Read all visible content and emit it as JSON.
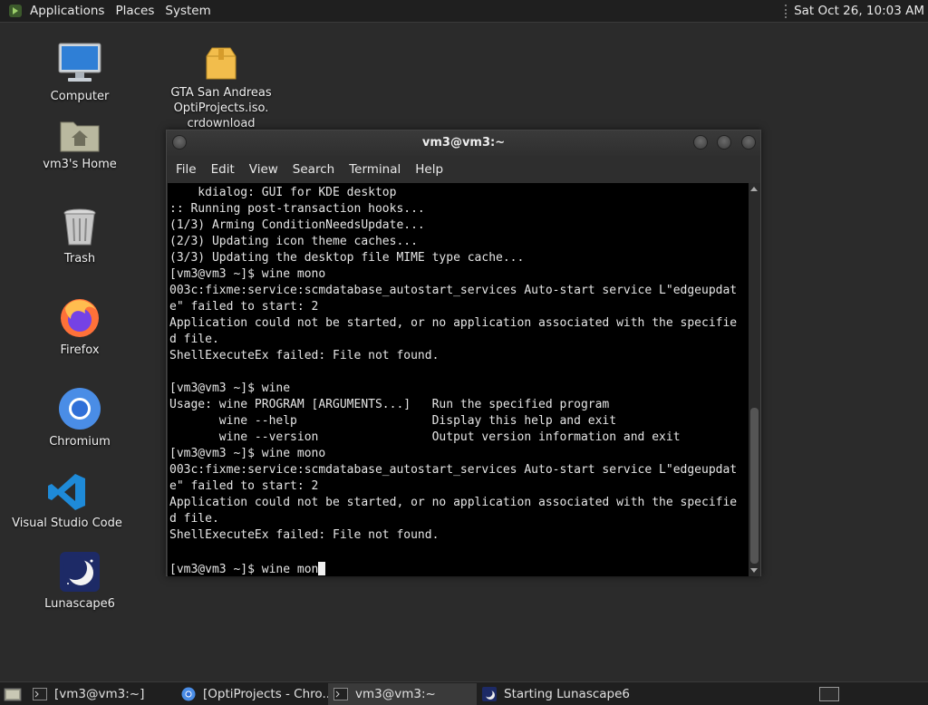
{
  "top_panel": {
    "menus": [
      "Applications",
      "Places",
      "System"
    ],
    "clock": "Sat Oct 26, 10:03 AM"
  },
  "desktop_icons": [
    {
      "label": "Computer",
      "icon": "computer-icon"
    },
    {
      "label": "vm3's Home",
      "icon": "home-folder-icon"
    },
    {
      "label": "Trash",
      "icon": "trash-icon"
    },
    {
      "label": "Firefox",
      "icon": "firefox-icon"
    },
    {
      "label": "Chromium",
      "icon": "chromium-icon"
    },
    {
      "label": "Visual Studio Code",
      "icon": "vscode-icon"
    },
    {
      "label": "Lunascape6",
      "icon": "lunascape-icon"
    },
    {
      "label_lines": [
        "GTA San Andreas",
        "OptiProjects.iso.",
        "crdownload"
      ],
      "icon": "archive-file-icon"
    }
  ],
  "terminal": {
    "title": "vm3@vm3:~",
    "menu": [
      "File",
      "Edit",
      "View",
      "Search",
      "Terminal",
      "Help"
    ],
    "lines": [
      "    kdialog: GUI for KDE desktop",
      ":: Running post-transaction hooks...",
      "(1/3) Arming ConditionNeedsUpdate...",
      "(2/3) Updating icon theme caches...",
      "(3/3) Updating the desktop file MIME type cache...",
      "[vm3@vm3 ~]$ wine mono",
      "003c:fixme:service:scmdatabase_autostart_services Auto-start service L\"edgeupdat",
      "e\" failed to start: 2",
      "Application could not be started, or no application associated with the specifie",
      "d file.",
      "ShellExecuteEx failed: File not found.",
      "",
      "[vm3@vm3 ~]$ wine",
      "Usage: wine PROGRAM [ARGUMENTS...]   Run the specified program",
      "       wine --help                   Display this help and exit",
      "       wine --version                Output version information and exit",
      "[vm3@vm3 ~]$ wine mono",
      "003c:fixme:service:scmdatabase_autostart_services Auto-start service L\"edgeupdat",
      "e\" failed to start: 2",
      "Application could not be started, or no application associated with the specifie",
      "d file.",
      "ShellExecuteEx failed: File not found.",
      ""
    ],
    "prompt_line": "[vm3@vm3 ~]$ wine mon"
  },
  "taskbar": {
    "tasks": [
      {
        "label": "[vm3@vm3:~]",
        "icon": "terminal-icon",
        "active": false
      },
      {
        "label": "[OptiProjects - Chro...",
        "icon": "chromium-icon",
        "active": false
      },
      {
        "label": "vm3@vm3:~",
        "icon": "terminal-icon",
        "active": true
      },
      {
        "label": "Starting Lunascape6",
        "icon": "lunascape-icon",
        "active": false
      }
    ]
  }
}
